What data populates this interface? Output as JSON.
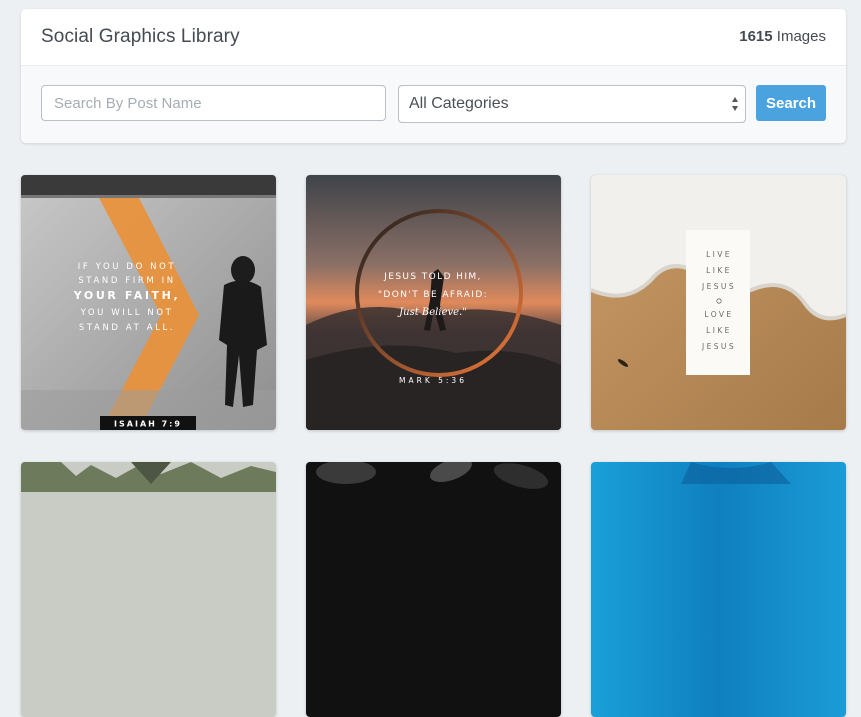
{
  "header": {
    "title": "Social Graphics Library",
    "count_number": "1615",
    "count_label": "Images"
  },
  "search": {
    "placeholder": "Search By Post Name",
    "value": "",
    "category_selected": "All Categories",
    "button_label": "Search"
  },
  "cards": [
    {
      "id": "isaiah",
      "lines": [
        "IF YOU DO NOT",
        "STAND FIRM IN",
        "YOUR FAITH,",
        "YOU WILL NOT",
        "STAND AT ALL."
      ],
      "reference": "ISAIAH 7:9"
    },
    {
      "id": "mark",
      "lines": [
        "JESUS TOLD HIM,",
        "\"DON'T BE AFRAID:"
      ],
      "script": "Just Believe.\"",
      "reference": "MARK 5:36"
    },
    {
      "id": "live-like-jesus",
      "lines": [
        "LIVE",
        "LIKE",
        "JESUS",
        "LOVE",
        "LIKE",
        "JESUS"
      ]
    }
  ],
  "colors": {
    "accent": "#4aa3df",
    "background": "#edf0f3"
  }
}
